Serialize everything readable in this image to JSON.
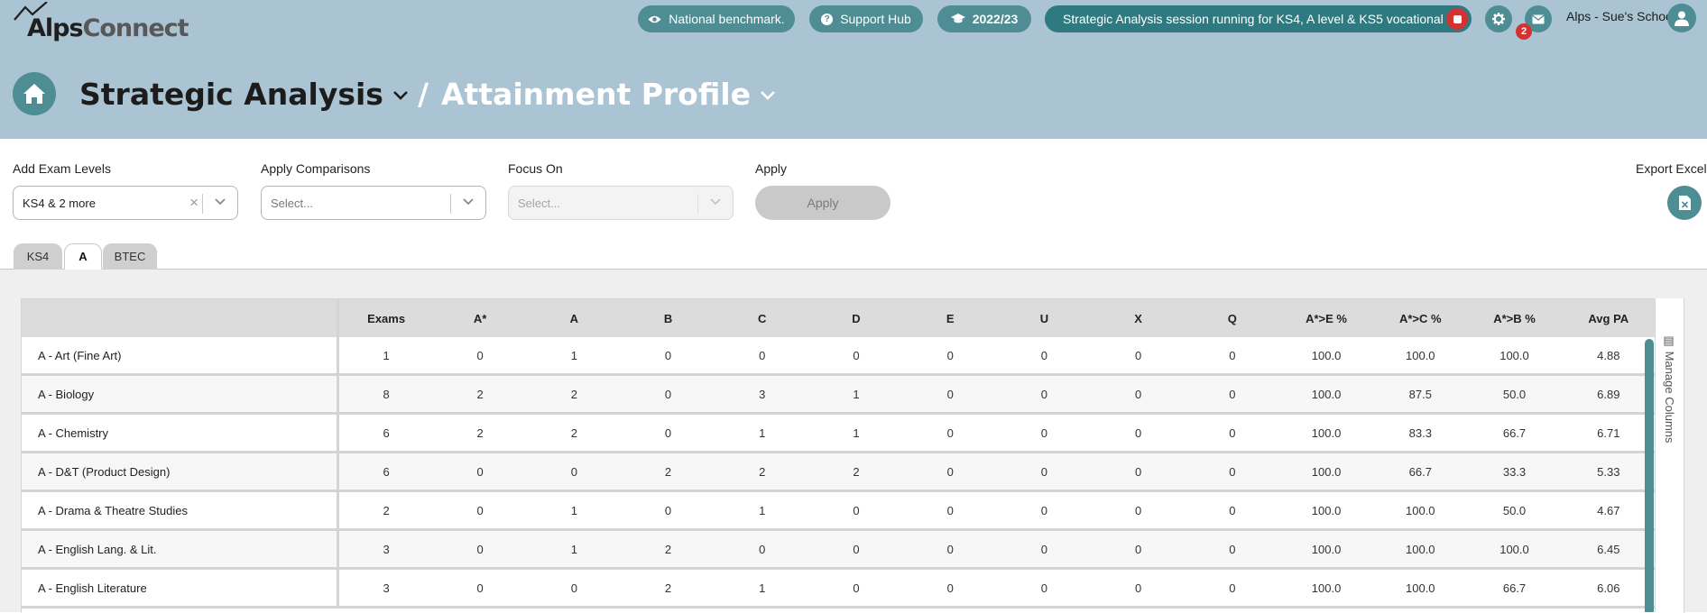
{
  "header": {
    "logo": {
      "alps": "Alps",
      "connect": "Connect"
    },
    "benchmark_label": "National benchmark.",
    "support_label": "Support Hub",
    "year_label": "2022/23",
    "session_text": "Strategic Analysis session running for KS4, A level & KS5 vocational",
    "notification_count": "2",
    "school_name": "Alps - Sue's School"
  },
  "breadcrumb": {
    "main": "Strategic Analysis",
    "separator": "/",
    "current": "Attainment Profile"
  },
  "filters": {
    "exam_levels_label": "Add Exam Levels",
    "exam_levels_value": "KS4 & 2 more",
    "comparisons_label": "Apply Comparisons",
    "comparisons_placeholder": "Select...",
    "focus_label": "Focus On",
    "focus_placeholder": "Select...",
    "apply_label": "Apply",
    "apply_button": "Apply",
    "export_label": "Export Excel"
  },
  "tabs": [
    "KS4",
    "A",
    "BTEC"
  ],
  "active_tab": "A",
  "table": {
    "columns": [
      "",
      "Exams",
      "A*",
      "A",
      "B",
      "C",
      "D",
      "E",
      "U",
      "X",
      "Q",
      "A*>E %",
      "A*>C %",
      "A*>B %",
      "Avg PA"
    ],
    "rows": [
      [
        "A - Art (Fine Art)",
        "1",
        "0",
        "1",
        "0",
        "0",
        "0",
        "0",
        "0",
        "0",
        "0",
        "100.0",
        "100.0",
        "100.0",
        "4.88"
      ],
      [
        "A - Biology",
        "8",
        "2",
        "2",
        "0",
        "3",
        "1",
        "0",
        "0",
        "0",
        "0",
        "100.0",
        "87.5",
        "50.0",
        "6.89"
      ],
      [
        "A - Chemistry",
        "6",
        "2",
        "2",
        "0",
        "1",
        "1",
        "0",
        "0",
        "0",
        "0",
        "100.0",
        "83.3",
        "66.7",
        "6.71"
      ],
      [
        "A - D&T (Product Design)",
        "6",
        "0",
        "0",
        "2",
        "2",
        "2",
        "0",
        "0",
        "0",
        "0",
        "100.0",
        "66.7",
        "33.3",
        "5.33"
      ],
      [
        "A - Drama & Theatre Studies",
        "2",
        "0",
        "1",
        "0",
        "1",
        "0",
        "0",
        "0",
        "0",
        "0",
        "100.0",
        "100.0",
        "50.0",
        "4.67"
      ],
      [
        "A - English Lang. & Lit.",
        "3",
        "0",
        "1",
        "2",
        "0",
        "0",
        "0",
        "0",
        "0",
        "0",
        "100.0",
        "100.0",
        "100.0",
        "6.45"
      ],
      [
        "A - English Literature",
        "3",
        "0",
        "0",
        "2",
        "1",
        "0",
        "0",
        "0",
        "0",
        "0",
        "100.0",
        "100.0",
        "66.7",
        "6.06"
      ]
    ]
  },
  "manage_columns_label": "Manage Columns",
  "colors": {
    "header_bg": "#abc4d3",
    "accent": "#4d8d93",
    "session_bg": "#2f7a80",
    "stop": "#d43232"
  }
}
